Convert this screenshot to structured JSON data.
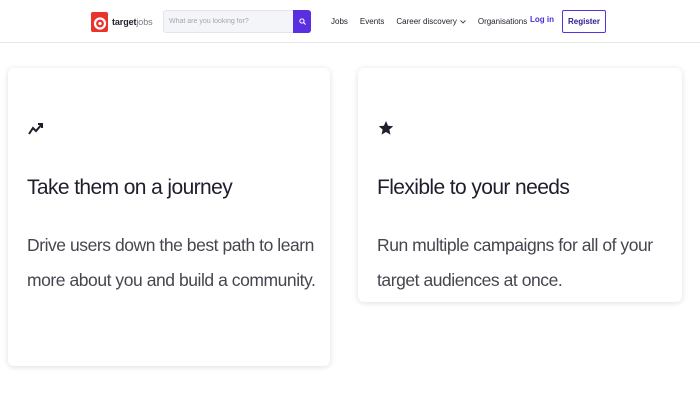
{
  "header": {
    "logo": {
      "name": "target",
      "suffix": "jobs"
    },
    "search": {
      "placeholder": "What are you looking for?",
      "value": ""
    },
    "nav": [
      {
        "label": "Jobs"
      },
      {
        "label": "Events"
      },
      {
        "label": "Career discovery",
        "has_dropdown": true
      },
      {
        "label": "Organisations"
      }
    ],
    "login_label": "Log in",
    "register_label": "Register"
  },
  "features": [
    {
      "icon": "trending-up-icon",
      "title": "Take them on a journey",
      "text": "Drive users down the best path to learn more about you and build a community."
    },
    {
      "icon": "star-icon",
      "title": "Flexible to your needs",
      "text": "Run multiple campaigns for all of your target audiences at once."
    }
  ],
  "colors": {
    "brand_red": "#e8342a",
    "accent_purple": "#5a2fe0",
    "login_text": "#4b2bd3"
  }
}
